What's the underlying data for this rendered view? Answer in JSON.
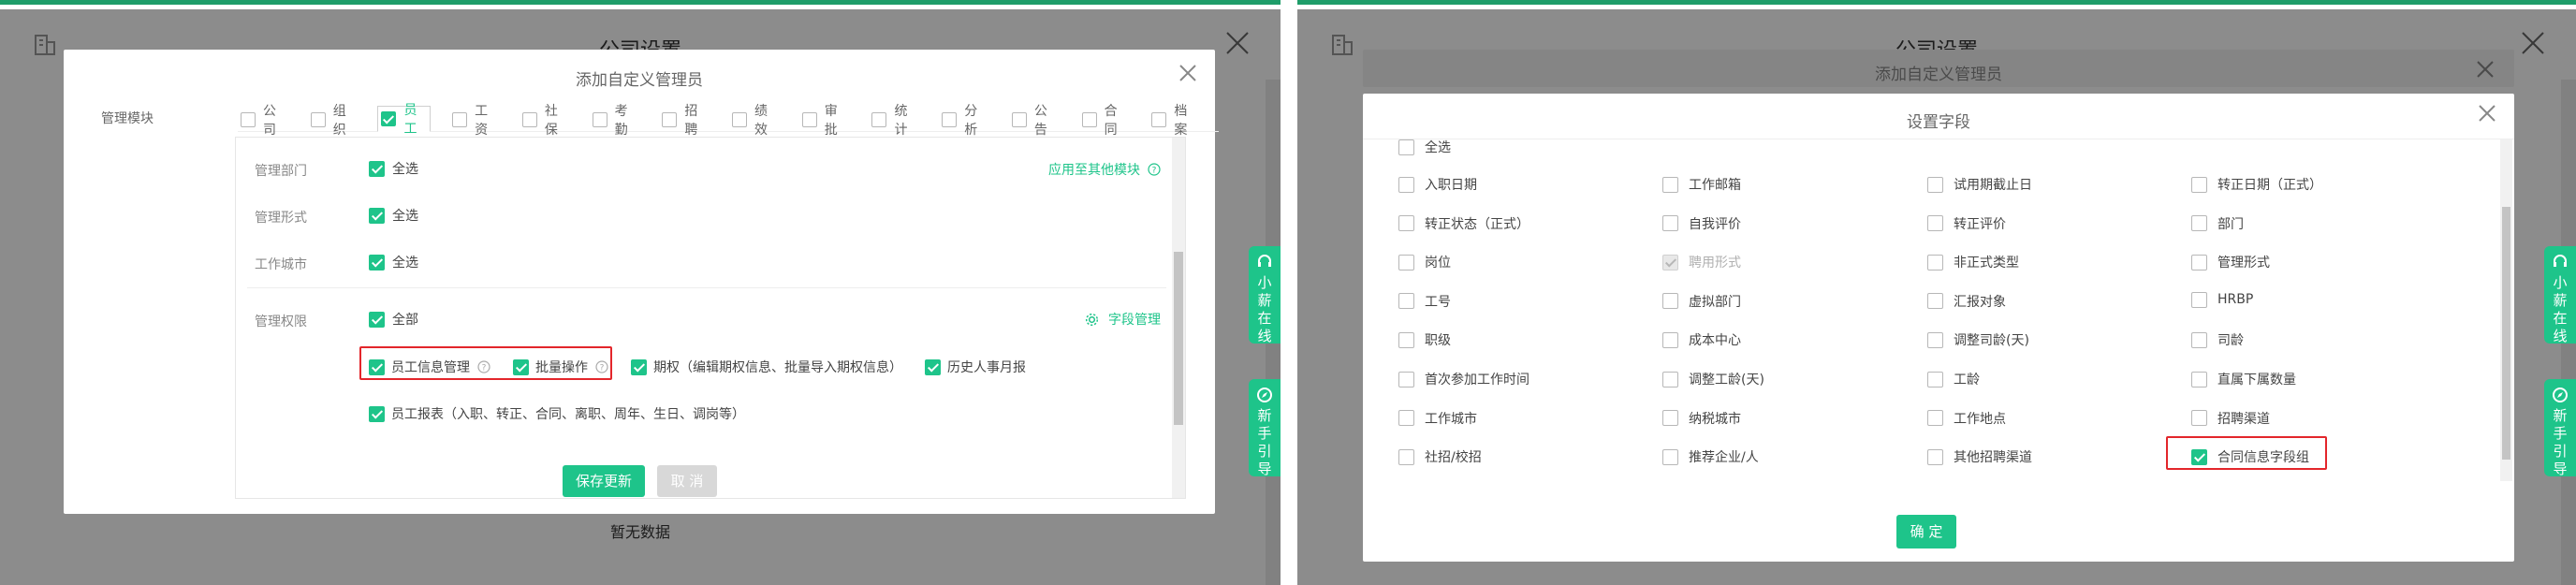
{
  "left": {
    "bg_title": "公司设置",
    "bg_empty": "暂无数据",
    "side_tabs": [
      "小薪在线",
      "新手引导"
    ],
    "modal": {
      "title": "添加自定义管理员",
      "module_label": "管理模块",
      "modules": [
        {
          "label": "公司",
          "checked": false
        },
        {
          "label": "组织",
          "checked": false
        },
        {
          "label": "员工",
          "checked": true,
          "active": true
        },
        {
          "label": "工资",
          "checked": false
        },
        {
          "label": "社保",
          "checked": false
        },
        {
          "label": "考勤",
          "checked": false
        },
        {
          "label": "招聘",
          "checked": false
        },
        {
          "label": "绩效",
          "checked": false
        },
        {
          "label": "审批",
          "checked": false
        },
        {
          "label": "统计",
          "checked": false
        },
        {
          "label": "分析",
          "checked": false
        },
        {
          "label": "公告",
          "checked": false
        },
        {
          "label": "合同",
          "checked": false
        },
        {
          "label": "档案",
          "checked": false
        }
      ],
      "rows": {
        "dept_label": "管理部门",
        "dept_value": "全选",
        "form_label": "管理形式",
        "form_value": "全选",
        "city_label": "工作城市",
        "city_value": "全选",
        "perm_label": "管理权限",
        "perm_value": "全部"
      },
      "apply_other": "应用至其他模块",
      "field_manage": "字段管理",
      "options": [
        "员工信息管理",
        "批量操作",
        "期权（编辑期权信息、批量导入期权信息）",
        "历史人事月报"
      ],
      "report_option": "员工报表（入职、转正、合同、离职、周年、生日、调岗等）",
      "save_button": "保存更新",
      "cancel_button": "取 消"
    }
  },
  "right": {
    "bg_title": "公司设置",
    "side_tabs": [
      "小薪在线",
      "新手引导"
    ],
    "back_modal_title": "添加自定义管理员",
    "modal": {
      "title": "设置字段",
      "select_all": "全选",
      "fields": [
        [
          "入职日期",
          "工作邮箱",
          "试用期截止日",
          "转正日期（正式）"
        ],
        [
          "转正状态（正式）",
          "自我评价",
          "转正评价",
          "部门"
        ],
        [
          "岗位",
          "聘用形式",
          "非正式类型",
          "管理形式"
        ],
        [
          "工号",
          "虚拟部门",
          "汇报对象",
          "HRBP"
        ],
        [
          "职级",
          "成本中心",
          "调整司龄(天)",
          "司龄"
        ],
        [
          "首次参加工作时间",
          "调整工龄(天)",
          "工龄",
          "直属下属数量"
        ],
        [
          "工作城市",
          "纳税城市",
          "工作地点",
          "招聘渠道"
        ],
        [
          "社招/校招",
          "推荐企业/人",
          "其他招聘渠道",
          "合同信息字段组"
        ]
      ],
      "confirm_button": "确 定"
    }
  }
}
